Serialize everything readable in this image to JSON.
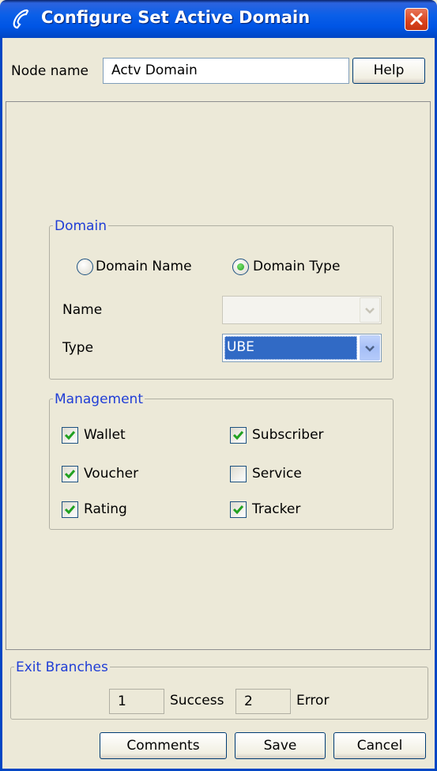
{
  "window": {
    "title": "Configure Set Active Domain",
    "icon": "phone-handset-icon",
    "close_icon": "close-icon",
    "accent_color": "#0055E5",
    "close_color": "#D9421C"
  },
  "node": {
    "label": "Node name",
    "value": "Actv Domain",
    "help_label": "Help"
  },
  "domain": {
    "legend": "Domain",
    "option_name": "Domain Name",
    "option_type": "Domain Type",
    "selected": "Domain Type",
    "name_label": "Name",
    "name_value": "",
    "type_label": "Type",
    "type_value": "UBE"
  },
  "management": {
    "legend": "Management",
    "items": [
      {
        "label": "Wallet",
        "checked": true
      },
      {
        "label": "Subscriber",
        "checked": true
      },
      {
        "label": "Voucher",
        "checked": true
      },
      {
        "label": "Service",
        "checked": false
      },
      {
        "label": "Rating",
        "checked": true
      },
      {
        "label": "Tracker",
        "checked": true
      }
    ]
  },
  "exit_branches": {
    "legend": "Exit Branches",
    "branches": [
      {
        "number": "1",
        "label": "Success"
      },
      {
        "number": "2",
        "label": "Error"
      }
    ]
  },
  "footer": {
    "comments_label": "Comments",
    "save_label": "Save",
    "cancel_label": "Cancel"
  }
}
